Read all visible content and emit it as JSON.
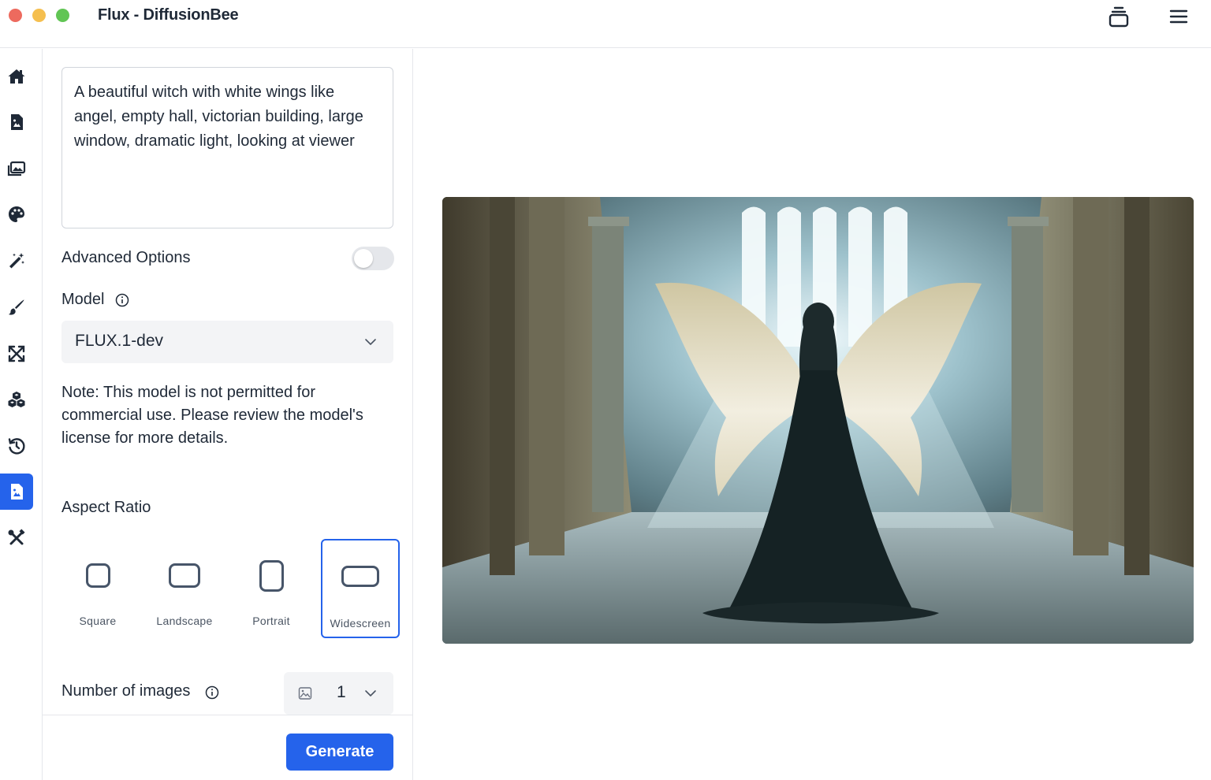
{
  "window": {
    "title": "Flux - DiffusionBee"
  },
  "titlebar": {
    "stack_icon": "stack-icon",
    "menu_icon": "hamburger-menu-icon"
  },
  "sidebar": {
    "items": [
      {
        "icon": "home-icon"
      },
      {
        "icon": "text-to-image-icon"
      },
      {
        "icon": "images-icon"
      },
      {
        "icon": "palette-icon"
      },
      {
        "icon": "magic-wand-icon"
      },
      {
        "icon": "brush-icon"
      },
      {
        "icon": "upscale-arrows-icon"
      },
      {
        "icon": "cubes-icon"
      },
      {
        "icon": "history-icon"
      },
      {
        "icon": "flux-image-icon",
        "active": true
      },
      {
        "icon": "tools-icon"
      }
    ],
    "active_color": "#2563eb"
  },
  "prompt": {
    "value": "A beautiful witch with white wings like angel, empty hall, victorian building, large window, dramatic light, looking at viewer"
  },
  "advanced_options": {
    "label": "Advanced Options",
    "enabled": false
  },
  "model": {
    "label": "Model",
    "selected": "FLUX.1-dev"
  },
  "note": "Note: This model is not permitted for commercial use. Please review the model's license for more details.",
  "aspect_ratio": {
    "label": "Aspect Ratio",
    "options": [
      {
        "label": "Square"
      },
      {
        "label": "Landscape"
      },
      {
        "label": "Portrait"
      },
      {
        "label": "Widescreen",
        "selected": true
      }
    ]
  },
  "num_images": {
    "label": "Number of images",
    "value": "1"
  },
  "generate": {
    "label": "Generate"
  },
  "colors": {
    "accent": "#2563eb",
    "text": "#1f2937"
  }
}
